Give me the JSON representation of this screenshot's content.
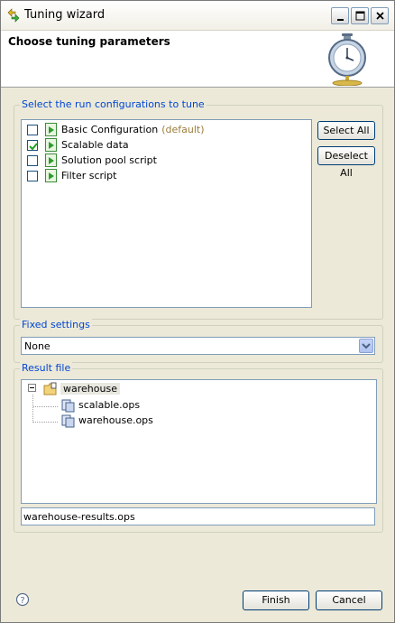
{
  "window": {
    "title": "Tuning wizard",
    "controls": [
      "minimize-icon",
      "maximize-icon",
      "close-icon"
    ]
  },
  "banner": {
    "title": "Choose tuning parameters",
    "icon": "stopwatch-icon"
  },
  "run_configs": {
    "label": "Select the run configurations to tune",
    "items": [
      {
        "label": "Basic Configuration",
        "suffix": "(default)",
        "checked": false
      },
      {
        "label": "Scalable data",
        "suffix": "",
        "checked": true
      },
      {
        "label": "Solution pool script",
        "suffix": "",
        "checked": false
      },
      {
        "label": "Filter script",
        "suffix": "",
        "checked": false
      }
    ],
    "select_all": "Select All",
    "deselect_all": "Deselect All"
  },
  "fixed_settings": {
    "label": "Fixed settings",
    "selected": "None"
  },
  "result_file": {
    "label": "Result file",
    "tree": {
      "project": "warehouse",
      "children": [
        "scalable.ops",
        "warehouse.ops"
      ]
    },
    "filename": "warehouse-results.ops"
  },
  "footer": {
    "finish": "Finish",
    "cancel": "Cancel",
    "help_icon": "help-icon"
  }
}
